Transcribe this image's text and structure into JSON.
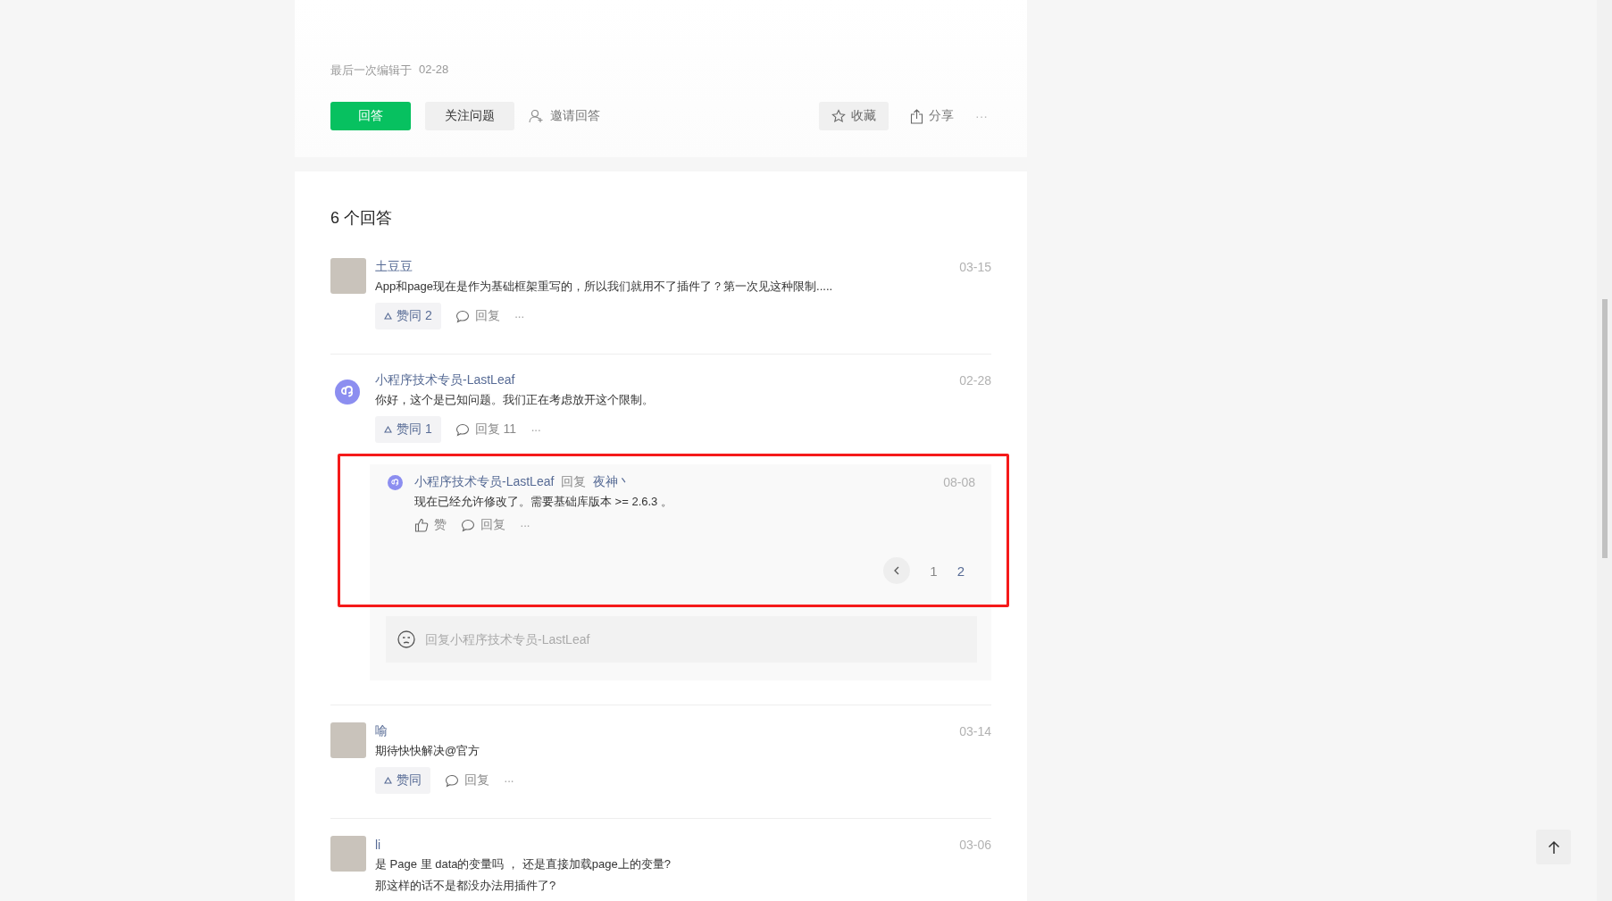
{
  "question": {
    "edited_label": "最后一次编辑于",
    "edited_date": "02-28",
    "actions": [
      {
        "kind": "primary",
        "label": "回答"
      },
      {
        "kind": "secondary",
        "label": "关注问题"
      },
      {
        "kind": "invite",
        "label": "邀请回答"
      }
    ],
    "right_actions": [
      {
        "kind": "favorite",
        "label": "收藏"
      },
      {
        "kind": "share",
        "label": "分享"
      },
      {
        "kind": "more",
        "label": "···"
      }
    ]
  },
  "answers": {
    "title": "6 个回答",
    "items": [
      {
        "author": "土豆豆",
        "kind": "photo",
        "date": "03-15",
        "text": [
          "App和page现在是作为基础框架重写的，所以我们就用不了插件了？第一次见这种限制....."
        ],
        "like_label": "赞同 2",
        "reply_label": "回复",
        "more": "···"
      },
      {
        "author": "小程序技术专员-LastLeaf",
        "kind": "logo",
        "date": "02-28",
        "text": [
          "你好，这个是已知问题。我们正在考虑放开这个限制。"
        ],
        "like_label": "赞同 1",
        "reply_label": "回复 11",
        "more": "···",
        "thread": {
          "highlighted": true,
          "replies": [
            {
              "author": "小程序技术专员-LastLeaf",
              "reply_word": "回复",
              "reply_to": "夜神丶",
              "date": "08-08",
              "text": "现在已经允许修改了。需要基础库版本 >= 2.6.3 。",
              "like_label": "赞",
              "reply_label": "回复",
              "more": "···"
            }
          ],
          "pages": [
            {
              "label": "1",
              "selected": false
            },
            {
              "label": "2",
              "selected": true
            }
          ],
          "reply_box": {
            "placeholder": "回复小程序技术专员-LastLeaf"
          }
        }
      },
      {
        "author": "喻",
        "kind": "photo",
        "date": "03-14",
        "text": [
          "期待快快解决@官方"
        ],
        "like_label": "赞同",
        "reply_label": "回复",
        "more": "···"
      },
      {
        "author": "li",
        "kind": "photo",
        "date": "03-06",
        "text": [
          "是 Page 里 data的变量吗 ， 还是直接加载page上的变量?",
          "那这样的话不是都没办法用插件了?"
        ]
      }
    ]
  }
}
